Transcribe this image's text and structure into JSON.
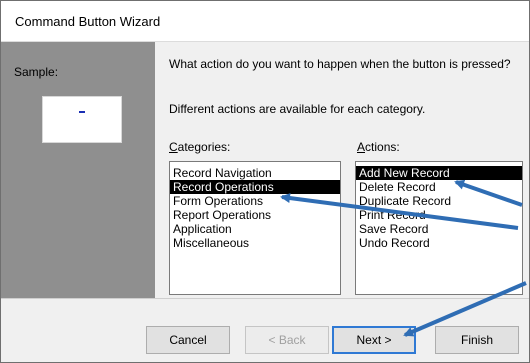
{
  "window": {
    "title": "Command Button Wizard"
  },
  "sample": {
    "label": "Sample:"
  },
  "prompt": {
    "question": "What action do you want to happen when the button is pressed?",
    "hint": "Different actions are available for each category."
  },
  "categories": {
    "label_prefix": "",
    "label_underline": "C",
    "label_rest": "ategories:",
    "items": [
      "Record Navigation",
      "Record Operations",
      "Form Operations",
      "Report Operations",
      "Application",
      "Miscellaneous"
    ],
    "selected": "Record Operations"
  },
  "actions": {
    "label_underline": "A",
    "label_rest": "ctions:",
    "items": [
      "Add New Record",
      "Delete Record",
      "Duplicate Record",
      "Print Record",
      "Save Record",
      "Undo Record"
    ],
    "selected": "Add New Record"
  },
  "buttons": {
    "cancel": "Cancel",
    "back": "< Back",
    "next": "Next >",
    "finish": "Finish"
  },
  "colors": {
    "annotation_arrow": "#2f6db4",
    "selection": "#000000",
    "sample_panel": "#8f8f8f"
  }
}
